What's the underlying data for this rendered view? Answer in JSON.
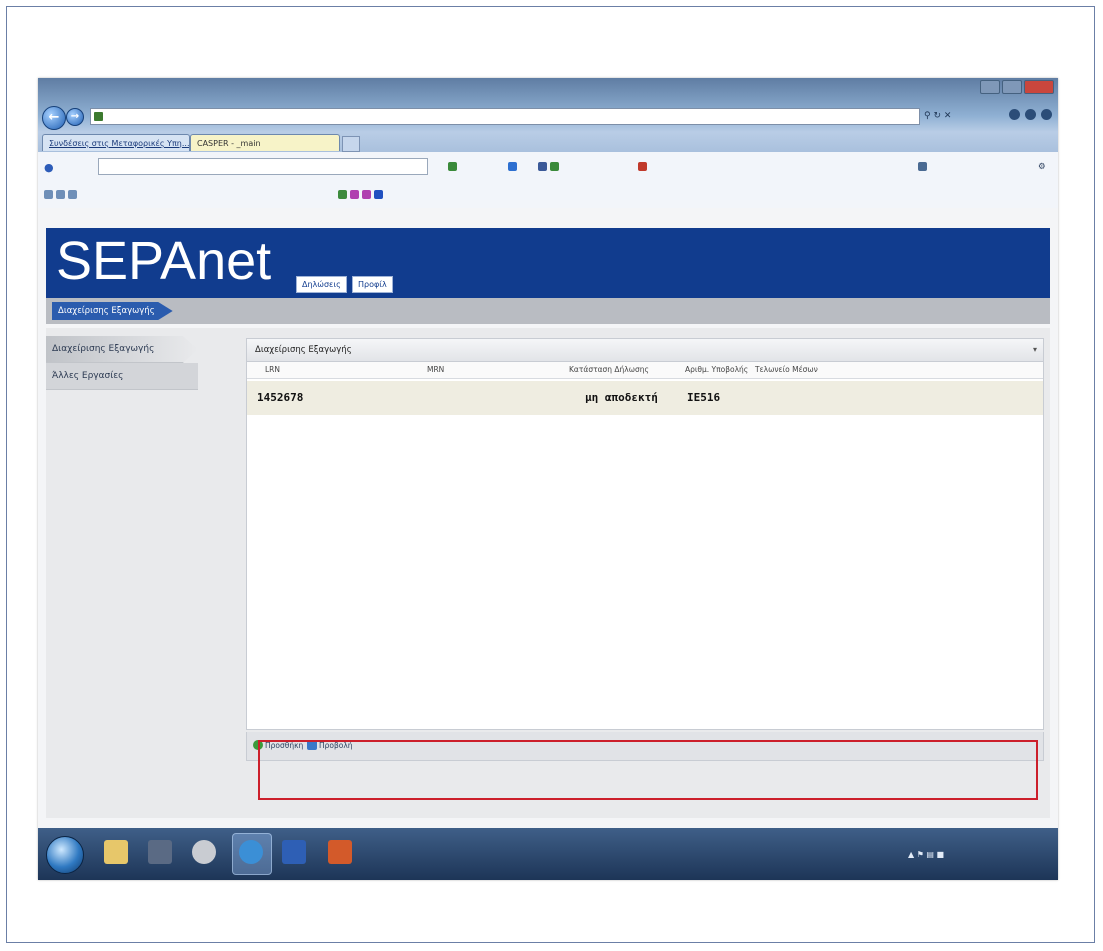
{
  "browser": {
    "tabs": [
      {
        "label": "Συνδέσεις στις Μεταφορικές Υπη..."
      },
      {
        "label": "CASPER - _main"
      }
    ]
  },
  "site": {
    "logo": "SEPAnet",
    "banner_buttons": [
      "Δηλώσεις",
      "Προφίλ"
    ],
    "breadcrumb": "Διαχείρισης Εξαγωγής"
  },
  "sidebar": {
    "items": [
      {
        "label": "Διαχείρισης Εξαγωγής",
        "active": true
      },
      {
        "label": "Άλλες Εργασίες",
        "active": false
      }
    ]
  },
  "panel": {
    "title": "Διαχείρισης Εξαγωγής",
    "columns": [
      "LRN",
      "MRN",
      "Κατάσταση Δήλωσης",
      "Αριθμ. Υποβολής",
      "Τελωνείο Μέσων"
    ],
    "rows": [
      {
        "lrn": "1452678",
        "mrn": "",
        "status": "μη αποδεκτή",
        "submission": "IE516"
      }
    ],
    "footer_buttons": [
      "Προσθήκη",
      "Προβολή"
    ]
  },
  "colors": {
    "banner": "#113c8e",
    "highlight": "#cc1f2b",
    "row_bg": "#efede1"
  }
}
